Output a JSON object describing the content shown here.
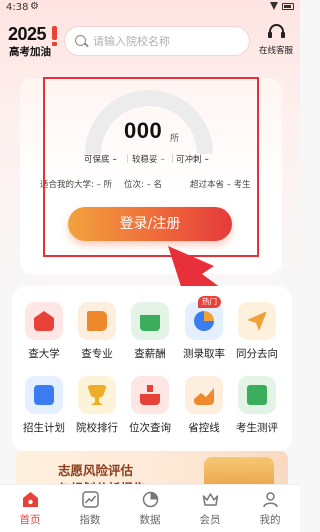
{
  "status_bar": {
    "time": "4:38"
  },
  "header": {
    "logo_year": "2025",
    "logo_slogan": "高考加油",
    "search_placeholder": "请输入院校名称",
    "service_label": "在线客服"
  },
  "card": {
    "count": "000",
    "count_unit": "所",
    "stats": [
      {
        "label": "可保底",
        "value": "–",
        "color": "#3b7cf0"
      },
      {
        "label": "较稳妥",
        "value": "–",
        "color": "#f0a23a"
      },
      {
        "label": "可冲刺",
        "value": "–",
        "color": "#e8413a"
      }
    ],
    "info": [
      {
        "text": "适合我的大学: – 所"
      },
      {
        "text": "位次: – 名"
      },
      {
        "text": "超过本省 – 考生"
      }
    ],
    "login_label": "登录/注册"
  },
  "tiles": [
    {
      "label": "查大学",
      "icon": "school-icon",
      "bg": "#fde6e4",
      "fg": "#e8413a"
    },
    {
      "label": "查专业",
      "icon": "book-icon",
      "bg": "#fdeedd",
      "fg": "#ee8a2c"
    },
    {
      "label": "查薪酬",
      "icon": "money-icon",
      "bg": "#e3f4e6",
      "fg": "#3aae5c"
    },
    {
      "label": "测录取率",
      "icon": "pie-chart-icon",
      "bg": "#e4efff",
      "fg": "#3b7cf0",
      "badge": "热门"
    },
    {
      "label": "同分去向",
      "icon": "paper-plane-icon",
      "bg": "#fdf1dc",
      "fg": "#f0a23a"
    },
    {
      "label": "招生计划",
      "icon": "plan-icon",
      "bg": "#e4efff",
      "fg": "#3b7cf0"
    },
    {
      "label": "院校排行",
      "icon": "trophy-icon",
      "bg": "#fdf3d8",
      "fg": "#eeae2a"
    },
    {
      "label": "位次查询",
      "icon": "person-rank-icon",
      "bg": "#fde6e4",
      "fg": "#e8413a"
    },
    {
      "label": "省控线",
      "icon": "line-chart-icon",
      "bg": "#fdeedd",
      "fg": "#ee8a2c"
    },
    {
      "label": "考生测评",
      "icon": "clipboard-icon",
      "bg": "#e3f4e6",
      "fg": "#3aae5c"
    }
  ],
  "banner": {
    "title": "志愿风险评估",
    "subtitle": "与规划分析报告"
  },
  "tabs": [
    {
      "label": "首页",
      "icon": "home-icon",
      "active": true
    },
    {
      "label": "指数",
      "icon": "trend-icon",
      "active": false
    },
    {
      "label": "数据",
      "icon": "data-chart-icon",
      "active": false
    },
    {
      "label": "会员",
      "icon": "crown-icon",
      "active": false
    },
    {
      "label": "我的",
      "icon": "user-icon",
      "active": false
    }
  ],
  "colors": {
    "accent": "#e8413a",
    "annotation": "#e8303a"
  }
}
